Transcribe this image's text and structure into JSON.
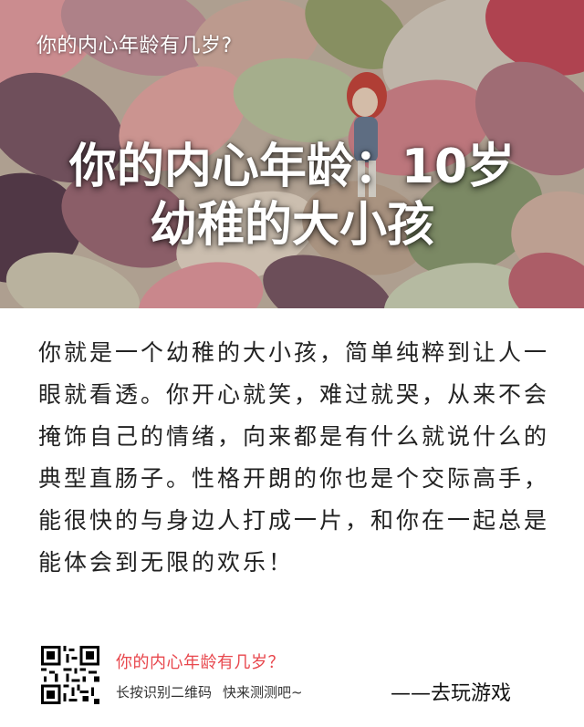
{
  "header": {
    "title": "你的内心年龄有几岁?"
  },
  "result": {
    "line1": "你的内心年龄：10岁",
    "line2": "幼稚的大小孩"
  },
  "description": "你就是一个幼稚的大小孩，简单纯粹到让人一眼就看透。你开心就笑，难过就哭，从来不会掩饰自己的情绪，向来都是有什么就说什么的典型直肠子。性格开朗的你也是个交际高手，能很快的与身边人打成一片，和你在一起总是能体会到无限的欢乐！",
  "footer": {
    "title": "你的内心年龄有几岁？",
    "hint": "长按识别二维码",
    "cta": "快来测测吧~",
    "brand": "——去玩游戏"
  },
  "colors": {
    "accent": "#e8474d"
  }
}
